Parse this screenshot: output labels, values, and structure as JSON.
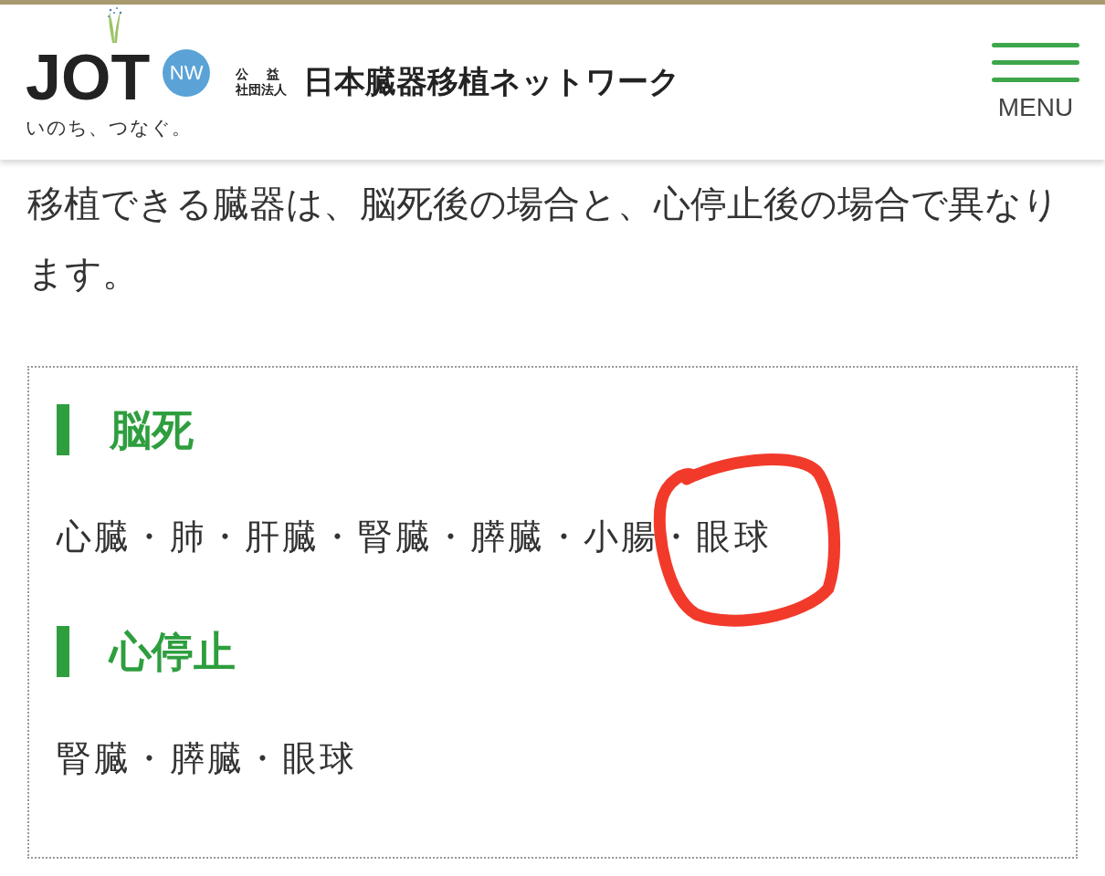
{
  "header": {
    "logo": {
      "wordmark": "JOT",
      "badge": "NW",
      "tagline": "いのち、つなぐ。"
    },
    "org": {
      "type_top": "公益",
      "type_bottom": "社団法人",
      "name": "日本臓器移植ネットワーク"
    },
    "menu": {
      "label": "MENU"
    }
  },
  "intro": "移植できる臓器は、脳死後の場合と、心停止後の場合で異なります。",
  "sections": [
    {
      "heading": "脳死",
      "organs": "心臓・肺・肝臓・腎臓・膵臓・小腸・眼球"
    },
    {
      "heading": "心停止",
      "organs": "腎臓・膵臓・眼球"
    }
  ]
}
